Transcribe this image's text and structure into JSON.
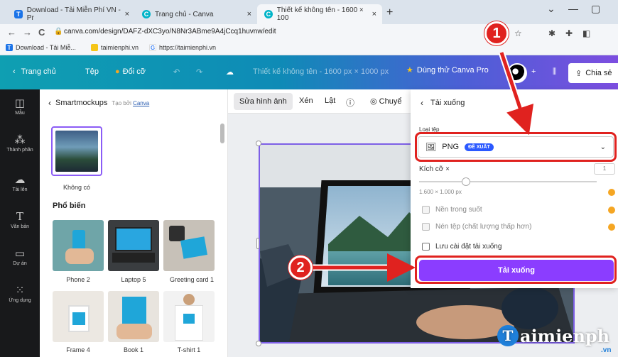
{
  "browser": {
    "tabs": [
      {
        "label": "Download - Tải Miễn Phí VN - Pr",
        "icon": "T",
        "close": "×"
      },
      {
        "label": "Trang chủ - Canva",
        "icon": "C",
        "close": "×"
      },
      {
        "label": "Thiết kế không tên - 1600 × 100",
        "icon": "C",
        "close": "×"
      }
    ],
    "new_tab": "+",
    "url": "canva.com/design/DAFZ-dXC3yo/N8Nr3ABme9A4jCcq1huvnw/edit",
    "bookmarks": [
      {
        "label": "Download - Tải Miễ...",
        "icon": "T"
      },
      {
        "label": "taimienphi.vn",
        "icon": ""
      },
      {
        "label": "https://taimienphi.vn",
        "icon": "G"
      }
    ]
  },
  "canva_header": {
    "home": "Trang chủ",
    "file": "Tệp",
    "resize": "Đổi cỡ",
    "title": "Thiết kế không tên - 1600 px × 1000 px",
    "try_pro": "Dùng thử Canva Pro",
    "share": "Chia sẻ"
  },
  "rail": [
    {
      "label": "Mẫu",
      "icon": "template-icon"
    },
    {
      "label": "Thành phần",
      "icon": "elements-icon"
    },
    {
      "label": "Tải lên",
      "icon": "upload-icon"
    },
    {
      "label": "Văn bản",
      "icon": "text-icon"
    },
    {
      "label": "Dự án",
      "icon": "folder-icon"
    },
    {
      "label": "Ứng dụng",
      "icon": "apps-icon"
    }
  ],
  "panel": {
    "title": "Smartmockups",
    "by_prefix": "Tạo bởi",
    "by_link": "Canva",
    "selected_label": "Không có",
    "section": "Phổ biến",
    "mockups": [
      {
        "label": "Phone 2"
      },
      {
        "label": "Laptop 5"
      },
      {
        "label": "Greeting card 1"
      },
      {
        "label": "Frame 4"
      },
      {
        "label": "Book 1"
      },
      {
        "label": "T-shirt 1"
      }
    ]
  },
  "canvas_toolbar": {
    "edit_image": "Sửa hình ảnh",
    "crop": "Xén",
    "flip": "Lật",
    "info": "ⓘ",
    "animate": "Chuyể"
  },
  "download": {
    "title": "Tải xuống",
    "file_type_label": "Loại tệp",
    "file_type": "PNG",
    "badge": "ĐỀ XUẤT",
    "size_label": "Kích cỡ ×",
    "size_value": "1",
    "dims": "1.600 × 1.000 px",
    "options": [
      {
        "label": "Nền trong suốt",
        "enabled": false
      },
      {
        "label": "Nén tệp (chất lượng thấp hơn)",
        "enabled": false
      },
      {
        "label": "Lưu cài đặt tải xuống",
        "enabled": true
      }
    ],
    "button": "Tải xuống"
  },
  "annotations": {
    "step1": "1",
    "step2": "2",
    "color": "#e0221f"
  },
  "watermark": {
    "logo": "T",
    "text": "aimienph",
    "suffix": ".vn"
  }
}
